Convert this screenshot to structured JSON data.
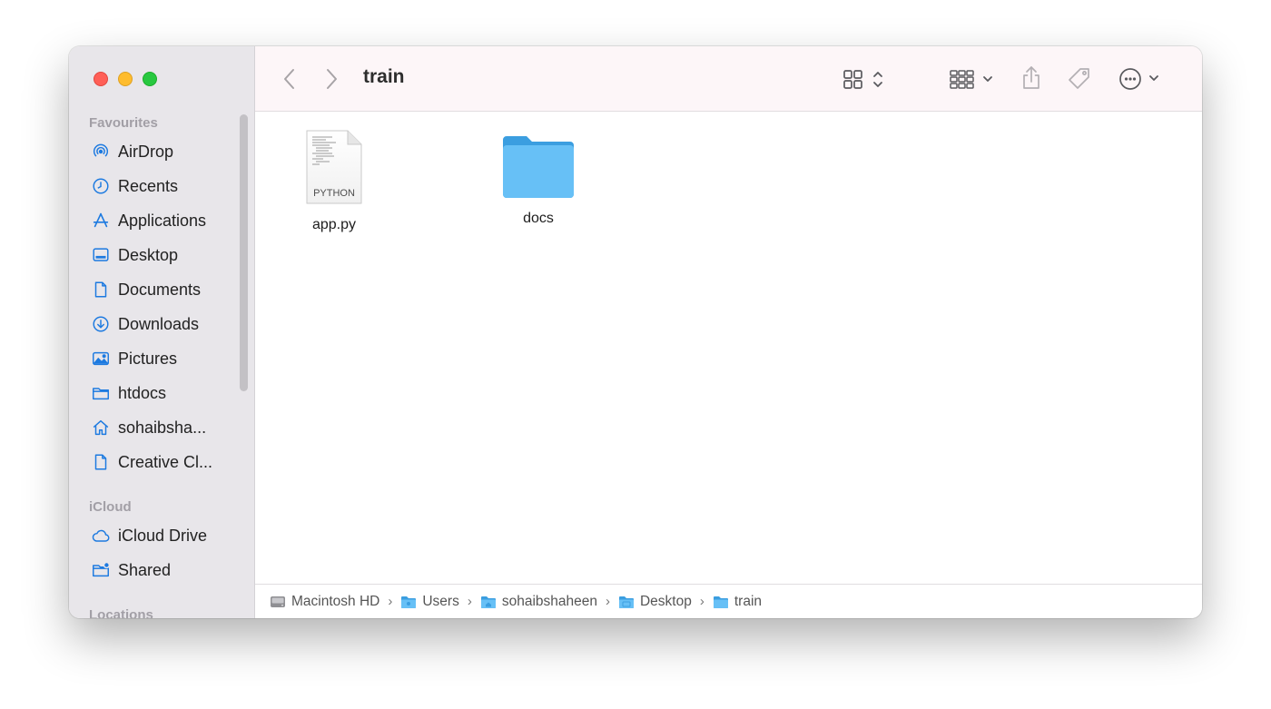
{
  "window": {
    "title": "train"
  },
  "sidebar": {
    "sections": [
      {
        "title": "Favourites"
      },
      {
        "title": "iCloud"
      },
      {
        "title": "Locations"
      }
    ],
    "favourites": [
      {
        "label": "AirDrop",
        "icon": "airdrop-icon"
      },
      {
        "label": "Recents",
        "icon": "clock-icon"
      },
      {
        "label": "Applications",
        "icon": "applications-icon"
      },
      {
        "label": "Desktop",
        "icon": "desktop-icon"
      },
      {
        "label": "Documents",
        "icon": "document-icon"
      },
      {
        "label": "Downloads",
        "icon": "download-icon"
      },
      {
        "label": "Pictures",
        "icon": "photo-icon"
      },
      {
        "label": "htdocs",
        "icon": "folder-icon"
      },
      {
        "label": "sohaibsha...",
        "icon": "home-icon"
      },
      {
        "label": "Creative Cl...",
        "icon": "document-icon"
      }
    ],
    "icloud": [
      {
        "label": "iCloud Drive",
        "icon": "cloud-icon"
      },
      {
        "label": "Shared",
        "icon": "shared-folder-icon"
      }
    ]
  },
  "files": [
    {
      "name": "app.py",
      "kind": "PYTHON",
      "icon": "python-file-icon"
    },
    {
      "name": "docs",
      "icon": "folder-icon"
    }
  ],
  "pathbar": [
    {
      "label": "Macintosh HD",
      "icon": "hard-drive-icon"
    },
    {
      "label": "Users",
      "icon": "folder-icon"
    },
    {
      "label": "sohaibshaheen",
      "icon": "home-folder-icon"
    },
    {
      "label": "Desktop",
      "icon": "desktop-folder-icon"
    },
    {
      "label": "train",
      "icon": "folder-icon"
    }
  ],
  "colors": {
    "accent": "#1d7ae0",
    "folder": "#62b9f1",
    "sidebar_bg": "#e8e6ea",
    "toolbar_bg": "#fdf6f8"
  }
}
